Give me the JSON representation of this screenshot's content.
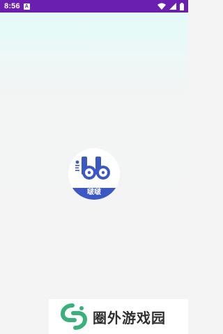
{
  "status_bar": {
    "time": "8:56",
    "notification_icon": "A",
    "icons": [
      "wifi-icon",
      "signal-icon",
      "battery-icon"
    ],
    "background": "#6a1fb0"
  },
  "splash": {
    "background_top": "#e3fbf9",
    "background": "#f4f4f4",
    "app_logo": {
      "label": "啵啵",
      "accent": "#3b58c4"
    }
  },
  "watermark": {
    "text": "圈外游戏园",
    "logo_color": "#38b27a"
  }
}
